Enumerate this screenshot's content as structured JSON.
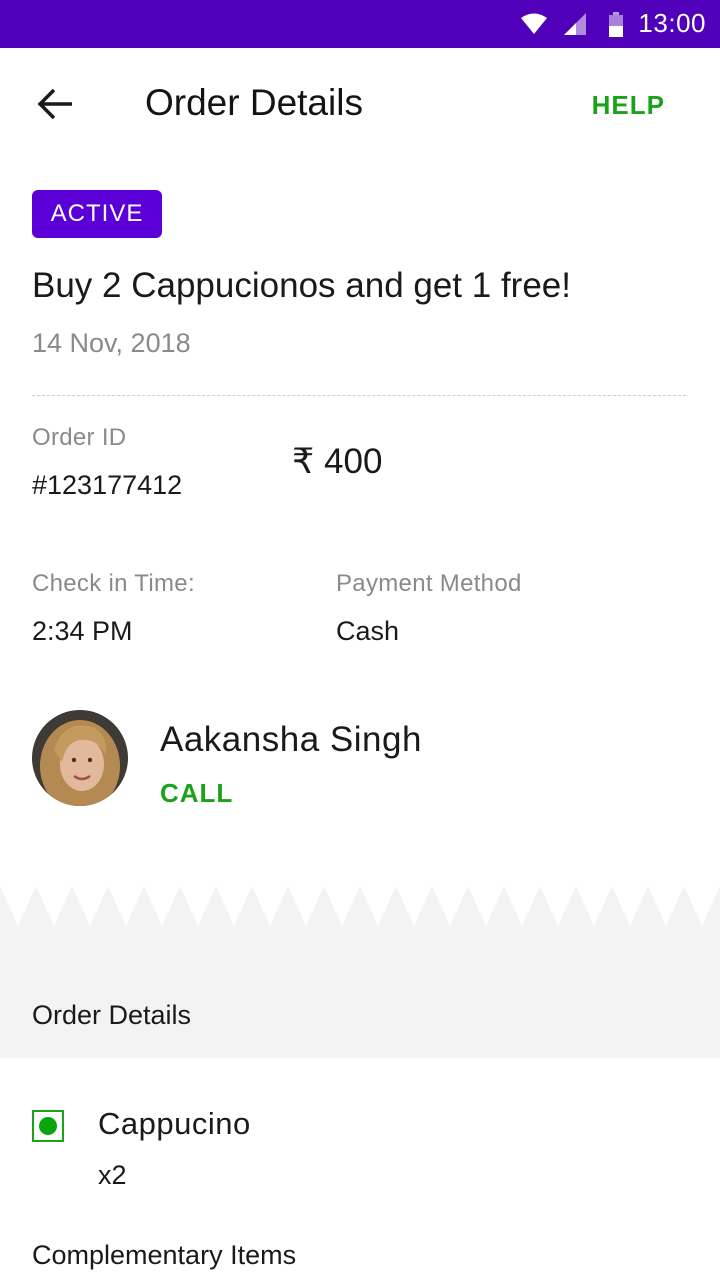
{
  "status_bar": {
    "time": "13:00",
    "icons": [
      "wifi-icon",
      "cell-signal-icon",
      "battery-icon"
    ]
  },
  "app_bar": {
    "title": "Order Details",
    "help_label": "HELP",
    "back_icon": "arrow-left-icon"
  },
  "order": {
    "status": "ACTIVE",
    "offer_title": "Buy 2 Cappucionos and get 1 free!",
    "date": "14 Nov, 2018",
    "order_id_label": "Order ID",
    "order_id": "#123177412",
    "currency_symbol": "₹",
    "amount": "400",
    "checkin_label": "Check in Time:",
    "checkin_time": "2:34 PM",
    "payment_label": "Payment Method",
    "payment_method": "Cash"
  },
  "customer": {
    "name": "Aakansha Singh",
    "call_label": "CALL"
  },
  "details_section": {
    "title": "Order Details",
    "items": [
      {
        "name": "Cappucino",
        "quantity": "x2",
        "veg": true
      }
    ],
    "complementary_title": "Complementary Items"
  },
  "colors": {
    "status_bar": "#5000b8",
    "badge": "#5a00d6",
    "accent_green": "#1aa31a",
    "section_grey": "#f3f3f3"
  }
}
